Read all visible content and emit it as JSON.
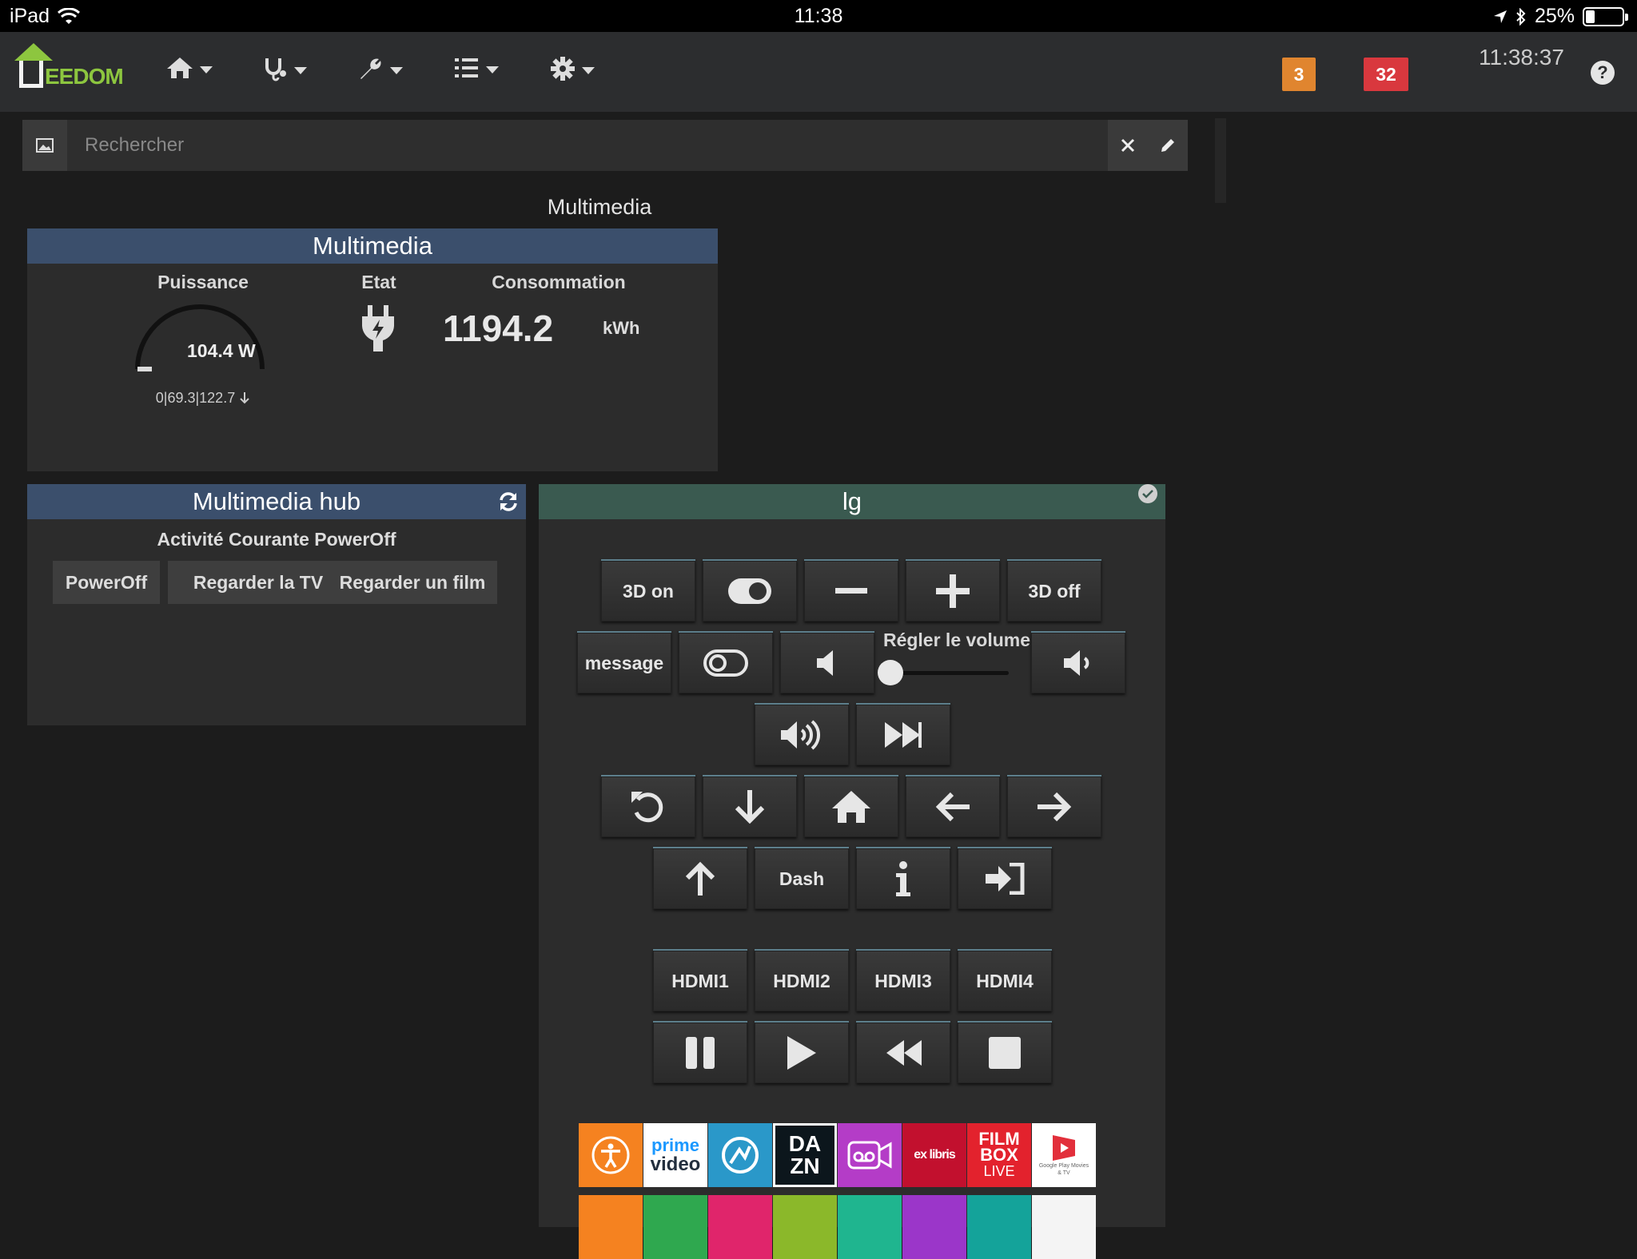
{
  "statusbar": {
    "device": "iPad",
    "time": "11:38",
    "battery": "25%",
    "battery_level": 0.25
  },
  "navbar": {
    "logo_text": "EEDOM",
    "menus": [
      "home-icon",
      "stethoscope-icon",
      "wrench-icon",
      "list-check-icon",
      "gear-icon"
    ],
    "badge_orange": "3",
    "badge_red": "32",
    "clock": "11:38:37",
    "help": "?"
  },
  "search": {
    "placeholder": "Rechercher",
    "value": ""
  },
  "object": {
    "title": "Multimedia"
  },
  "widget_multimedia": {
    "title": "Multimedia",
    "puissance_label": "Puissance",
    "etat_label": "Etat",
    "consommation_label": "Consommation",
    "puissance_value": "104.4 W",
    "puissance_stats": "0|69.3|122.7",
    "conso_value": "1194.2",
    "conso_unit": "kWh"
  },
  "widget_hub": {
    "title": "Multimedia hub",
    "activity": "Activité Courante PowerOff",
    "buttons": [
      "PowerOff",
      "Regarder la TV",
      "Regarder un film"
    ]
  },
  "widget_lg": {
    "title": "lg",
    "btn_3d_on": "3D on",
    "btn_3d_off": "3D off",
    "btn_message": "message",
    "volume_label": "Régler le volume",
    "volume_level": 0.0,
    "btn_dash": "Dash",
    "hdmi": [
      "HDMI1",
      "HDMI2",
      "HDMI3",
      "HDMI4"
    ]
  },
  "apps": {
    "prime": [
      "prime",
      "video"
    ],
    "dazn": [
      "DA",
      "ZN"
    ],
    "exlibris": "ex libris",
    "filmbox": [
      "FILM",
      "BOX",
      "LIVE"
    ],
    "gplay": "Google Play Movies & TV"
  }
}
